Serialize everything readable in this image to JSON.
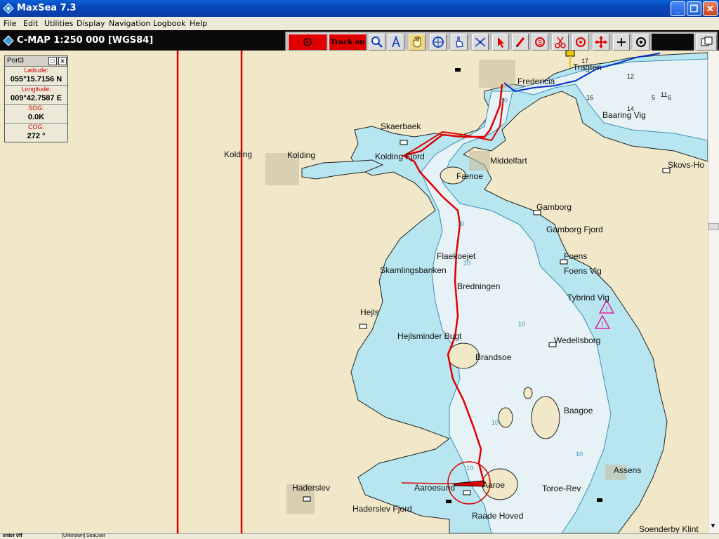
{
  "window": {
    "title": "MaxSea 7.3"
  },
  "menu": [
    "File",
    "Edit",
    "Utilities",
    "Display",
    "Navigation",
    "Logbook",
    "Help"
  ],
  "chart": {
    "title": "C-MAP  1:250 000 [WGS84]"
  },
  "toolbar": {
    "track_label": "Track on"
  },
  "port": {
    "title": "Port3",
    "fields": [
      {
        "label": "Latitude:",
        "value": "055°15.7156 N"
      },
      {
        "label": "Longitude:",
        "value": "009°42.7587 E"
      },
      {
        "label": "SOG:",
        "value": "0.0K"
      },
      {
        "label": "COG:",
        "value": "272 °"
      }
    ]
  },
  "map_labels": {
    "tragten": "Tragten",
    "fredericia": "Fredericia",
    "baaring_vig": "Baaring Vig",
    "skaerbaek": "Skaerbaek",
    "kolding_left": "Kolding",
    "kolding": "Kolding",
    "kolding_fjord": "Kolding Fjord",
    "middelfart": "Middelfart",
    "skovs_hoved": "Skovs-Ho",
    "fenoe": "Fænoe",
    "gamborg": "Gamborg",
    "gamborg_fjord": "Gamborg Fjord",
    "flaekoejet": "Flaekoejet",
    "foens": "Foens",
    "foens_vig": "Foens Vig",
    "skamlingsbanken": "Skamlingsbanken",
    "bredningen": "Bredningen",
    "tybrind_vig": "Tybrind Vig",
    "hejls": "Hejls",
    "hejlsminder_bugt": "Hejlsminder Bugt",
    "wedellsborg": "Wedellsborg",
    "brandsoe": "Brandsoe",
    "baagoe": "Baagoe",
    "assens": "Assens",
    "haderslev": "Haderslev",
    "aaroesund": "Aaroesund",
    "aaroe": "Aaroe",
    "toroe_rev": "Toroe-Rev",
    "haderslev_fjord": "Haderslev Fjord",
    "raade_hoved": "Raade Hoved",
    "soenderby_klint": "Soenderby Klint"
  },
  "depths": [
    "17",
    "12",
    "16",
    "14",
    "11",
    "6",
    "5",
    "10",
    "10",
    "10",
    "10",
    "10",
    "10",
    "10"
  ],
  "status": {
    "left": "enter 0ff",
    "user": "[Unknown] SeaUser"
  },
  "colors": {
    "land": "#f0e8c8",
    "shallow": "#b8e6f0",
    "deep": "#e6f2f6",
    "track": "#e00000",
    "route": "#0030c8"
  }
}
